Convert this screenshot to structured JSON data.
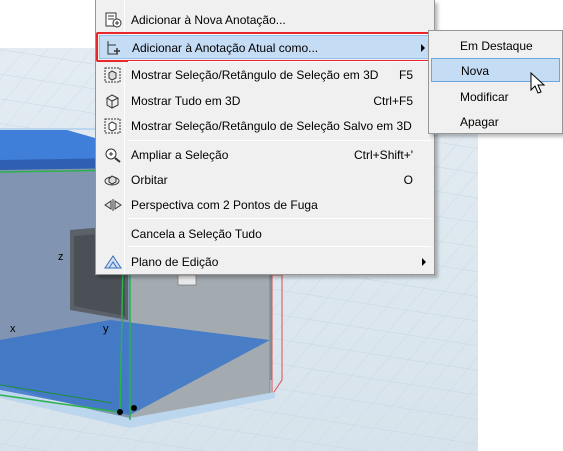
{
  "viewport": {
    "axis_labels": {
      "z": "z",
      "x": "x",
      "y": "y"
    }
  },
  "menu": {
    "items": [
      {
        "label": "Adicionar à Nova Anotação...",
        "shortcut": "",
        "icon": "add-annotation-icon",
        "submenu": false
      },
      {
        "label": "Adicionar à Anotação Atual como...",
        "shortcut": "",
        "icon": "add-current-annotation-icon",
        "submenu": true
      },
      {
        "label": "Mostrar Seleção/Retângulo de Seleção em 3D",
        "shortcut": "F5",
        "icon": "show-selection-3d-icon",
        "submenu": false
      },
      {
        "label": "Mostrar Tudo em 3D",
        "shortcut": "Ctrl+F5",
        "icon": "show-all-3d-icon",
        "submenu": false
      },
      {
        "label": "Mostrar Seleção/Retângulo de Seleção Salvo em 3D",
        "shortcut": "",
        "icon": "show-saved-selection-icon",
        "submenu": false
      },
      {
        "label": "Ampliar a Seleção",
        "shortcut": "Ctrl+Shift+'",
        "icon": "zoom-selection-icon",
        "submenu": false
      },
      {
        "label": "Orbitar",
        "shortcut": "O",
        "icon": "orbit-icon",
        "submenu": false
      },
      {
        "label": "Perspectiva com 2 Pontos de Fuga",
        "shortcut": "",
        "icon": "two-point-perspective-icon",
        "submenu": false
      },
      {
        "label": "Cancela a Seleção Tudo",
        "shortcut": "",
        "icon": "",
        "submenu": false
      },
      {
        "label": "Plano de Edição",
        "shortcut": "",
        "icon": "editing-plane-icon",
        "submenu": true
      }
    ]
  },
  "submenu": {
    "items": [
      {
        "label": "Em Destaque"
      },
      {
        "label": "Nova"
      },
      {
        "label": "Modificar"
      },
      {
        "label": "Apagar"
      }
    ]
  },
  "colors": {
    "highlight": "#c5dcf5",
    "highlight_border_red": "#e8262b",
    "slab_blue": "#3f7fd9",
    "selection_green": "#2bb24c"
  }
}
